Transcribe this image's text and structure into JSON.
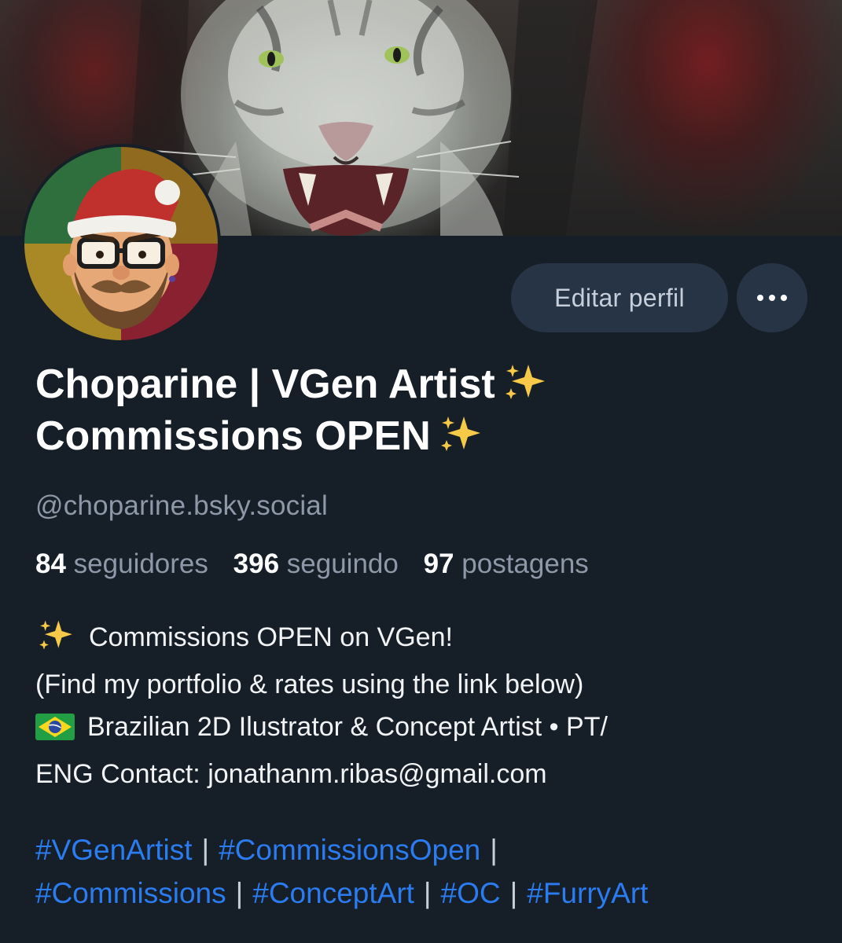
{
  "profile": {
    "display_name_line1": "Choparine | VGen Artist",
    "display_name_line2": "Commissions OPEN",
    "handle": "@choparine.bsky.social",
    "edit_button_label": "Editar perfil"
  },
  "stats": {
    "followers_count": "84",
    "followers_label": "seguidores",
    "following_count": "396",
    "following_label": "seguindo",
    "posts_count": "97",
    "posts_label": "postagens"
  },
  "bio": {
    "line1": "Commissions OPEN on VGen!",
    "line2": "(Find my portfolio & rates using the link below)",
    "line3": "Brazilian 2D Ilustrator & Concept Artist • PT/",
    "line4": "ENG Contact: jonathanm.ribas@gmail.com"
  },
  "hashtags": [
    "#VGenArtist",
    "#CommissionsOpen",
    "#Commissions",
    "#ConceptArt",
    "#OC",
    "#FurryArt"
  ],
  "separator": "|",
  "icons": {
    "sparkles": "sparkles-icon",
    "flag": "brazil-flag-icon",
    "more": "ellipsis-icon"
  },
  "colors": {
    "background": "#161e27",
    "button_bg": "#273445",
    "link": "#2a7cf0",
    "muted_text": "#8d99a8"
  }
}
